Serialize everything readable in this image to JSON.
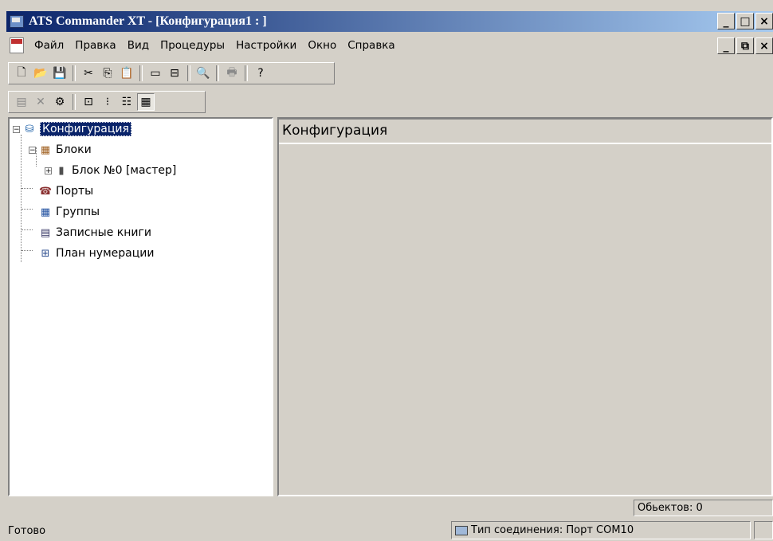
{
  "window": {
    "title": "ATS Commander XT - [Конфигурация1 : ]",
    "min_glyph": "_",
    "max_glyph": "□",
    "close_glyph": "×",
    "restore_glyph": "⧉"
  },
  "menu": {
    "items": [
      "Файл",
      "Правка",
      "Вид",
      "Процедуры",
      "Настройки",
      "Окно",
      "Справка"
    ]
  },
  "toolbar1": {
    "buttons": [
      {
        "icon": "new-document-icon",
        "glyph": "🗋"
      },
      {
        "icon": "open-folder-icon",
        "glyph": "📂"
      },
      {
        "icon": "save-icon",
        "glyph": "💾"
      },
      {
        "icon": "cut-icon",
        "glyph": "✂"
      },
      {
        "icon": "copy-icon",
        "glyph": "⎘"
      },
      {
        "icon": "paste-icon",
        "glyph": "📋"
      },
      {
        "icon": "new-item-icon",
        "glyph": "▭"
      },
      {
        "icon": "open-item-icon",
        "glyph": "⊟"
      },
      {
        "icon": "preview-icon",
        "glyph": "🔍"
      },
      {
        "icon": "print-icon",
        "glyph": "🖶"
      },
      {
        "icon": "help-icon",
        "glyph": "?"
      }
    ]
  },
  "toolbar2": {
    "buttons": [
      {
        "icon": "properties-icon",
        "glyph": "▤"
      },
      {
        "icon": "delete-icon",
        "glyph": "✕"
      },
      {
        "icon": "settings-icon",
        "glyph": "⚙"
      },
      {
        "icon": "large-icons-icon",
        "glyph": "⊡"
      },
      {
        "icon": "small-icons-icon",
        "glyph": "⁝"
      },
      {
        "icon": "list-view-icon",
        "glyph": "☷"
      },
      {
        "icon": "details-view-icon",
        "glyph": "▦"
      }
    ]
  },
  "tree": {
    "root": "Конфигурация",
    "blocks": "Блоки",
    "block0": "Блок №0 [мастер]",
    "ports": "Порты",
    "groups": "Группы",
    "notebooks": "Записные книги",
    "numbering": "План нумерации"
  },
  "detail": {
    "header": "Конфигурация"
  },
  "status": {
    "objects": "Обьектов: 0",
    "ready": "Готово",
    "connection": "Тип соединения: Порт COM10"
  }
}
